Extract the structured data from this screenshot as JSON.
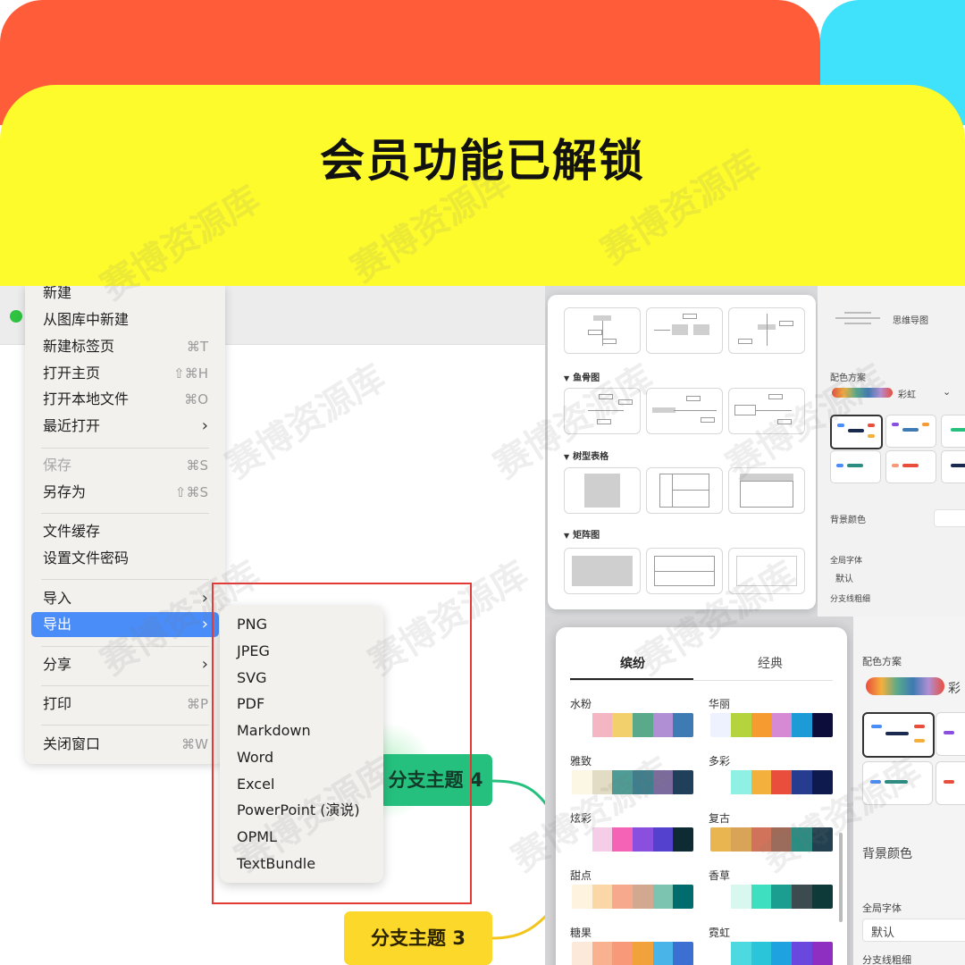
{
  "banner": {
    "title": "会员功能已解锁"
  },
  "menu": {
    "items": [
      {
        "label": "新建",
        "shortcut": ""
      },
      {
        "label": "从图库中新建",
        "shortcut": ""
      },
      {
        "label": "新建标签页",
        "shortcut": "⌘T"
      },
      {
        "label": "打开主页",
        "shortcut": "⇧⌘H"
      },
      {
        "label": "打开本地文件",
        "shortcut": "⌘O"
      },
      {
        "label": "最近打开",
        "shortcut": ""
      },
      {
        "label": "保存",
        "shortcut": "⌘S"
      },
      {
        "label": "另存为",
        "shortcut": "⇧⌘S"
      },
      {
        "label": "文件缓存",
        "shortcut": ""
      },
      {
        "label": "设置文件密码",
        "shortcut": ""
      },
      {
        "label": "导入",
        "shortcut": ""
      },
      {
        "label": "导出",
        "shortcut": ""
      },
      {
        "label": "分享",
        "shortcut": ""
      },
      {
        "label": "打印",
        "shortcut": "⌘P"
      },
      {
        "label": "关闭窗口",
        "shortcut": "⌘W"
      }
    ],
    "submenu_arrow": "›"
  },
  "export_submenu": [
    "PNG",
    "JPEG",
    "SVG",
    "PDF",
    "Markdown",
    "Word",
    "Excel",
    "PowerPoint (演说)",
    "OPML",
    "TextBundle"
  ],
  "canvas": {
    "node4": "分支主题 4",
    "node3": "分支主题 3"
  },
  "template_picker": {
    "sections": [
      "鱼骨图",
      "树型表格",
      "矩阵图"
    ],
    "side": {
      "structure": "思维导图",
      "scheme_label": "配色方案",
      "scheme_value": "彩虹",
      "bg_label": "背景颜色",
      "font_label": "全局字体",
      "font_value": "默认",
      "branch_label": "分支线粗细"
    }
  },
  "color_picker": {
    "tabs": [
      "缤纷",
      "经典"
    ],
    "palettes": [
      {
        "name": "水粉",
        "colors": [
          "#ffffff",
          "#f4b6c2",
          "#f2d06b",
          "#59a98a",
          "#b18fd4",
          "#3e7ab3"
        ]
      },
      {
        "name": "华丽",
        "colors": [
          "#eef2ff",
          "#b5d33d",
          "#f59b2f",
          "#d58ad3",
          "#1d9bd7",
          "#0d0d3b"
        ]
      },
      {
        "name": "雅致",
        "colors": [
          "#fbf7e4",
          "#e3dcc4",
          "#4e9c95",
          "#3f7e8c",
          "#7b6a9d",
          "#1f3f5b"
        ]
      },
      {
        "name": "多彩",
        "colors": [
          "#ffffff",
          "#8ff1e4",
          "#f4b03d",
          "#e94e3c",
          "#263d8f",
          "#0e1a4d"
        ]
      },
      {
        "name": "炫彩",
        "colors": [
          "#ffffff",
          "#f5cde6",
          "#f463b6",
          "#8b4fe0",
          "#5442cf",
          "#0e2b33"
        ]
      },
      {
        "name": "复古",
        "colors": [
          "#e8b551",
          "#d9a458",
          "#d0735a",
          "#9f6a58",
          "#2b8c82",
          "#22404f"
        ]
      },
      {
        "name": "甜点",
        "colors": [
          "#fdf3df",
          "#fbd7a8",
          "#f7a98e",
          "#d3a890",
          "#7cc3b0",
          "#006c6e"
        ]
      },
      {
        "name": "香草",
        "colors": [
          "#ffffff",
          "#d8f7ef",
          "#3ddfc0",
          "#1b9e8f",
          "#3c4b4f",
          "#0f3a3a"
        ]
      },
      {
        "name": "糖果",
        "colors": [
          "#fde9d9",
          "#f9b28f",
          "#f89a7a",
          "#f2a23a",
          "#49b4e8",
          "#3b6fd1"
        ]
      },
      {
        "name": "霓虹",
        "colors": [
          "#ffffff",
          "#4dd9e0",
          "#2bc5d9",
          "#1fa2e0",
          "#6a48dd",
          "#8e2fc2"
        ]
      }
    ],
    "side": {
      "scheme_label": "配色方案",
      "scheme_value": "彩",
      "bg_label": "背景颜色",
      "font_label": "全局字体",
      "font_value": "默认",
      "branch_label": "分支线粗细"
    }
  },
  "watermark": "赛博资源库"
}
